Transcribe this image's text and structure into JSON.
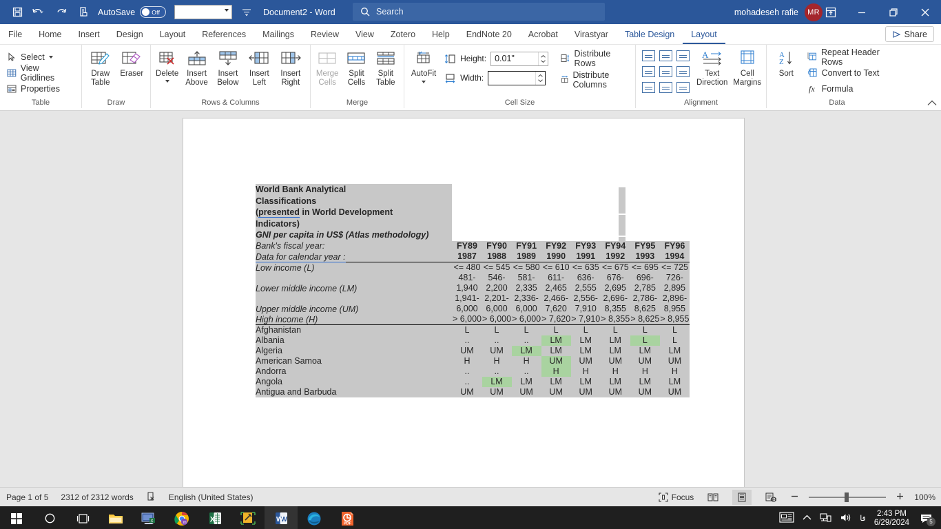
{
  "titlebar": {
    "autosave_label": "AutoSave",
    "autosave_state": "Off",
    "document_title": "Document2  -  Word",
    "search_placeholder": "Search",
    "account_name": "mohadeseh rafie",
    "account_initials": "MR",
    "icons": [
      "save-icon",
      "undo-icon",
      "redo-icon",
      "print-preview-icon",
      "customize-qat-icon",
      "ribbon-display-options-icon",
      "minimize-icon",
      "restore-icon",
      "close-icon"
    ]
  },
  "tabs": [
    {
      "label": "File",
      "state": "normal"
    },
    {
      "label": "Home",
      "state": "normal"
    },
    {
      "label": "Insert",
      "state": "normal"
    },
    {
      "label": "Design",
      "state": "normal"
    },
    {
      "label": "Layout",
      "state": "normal"
    },
    {
      "label": "References",
      "state": "normal"
    },
    {
      "label": "Mailings",
      "state": "normal"
    },
    {
      "label": "Review",
      "state": "normal"
    },
    {
      "label": "View",
      "state": "normal"
    },
    {
      "label": "Zotero",
      "state": "normal"
    },
    {
      "label": "Help",
      "state": "normal"
    },
    {
      "label": "EndNote 20",
      "state": "normal"
    },
    {
      "label": "Acrobat",
      "state": "normal"
    },
    {
      "label": "Virastyar",
      "state": "normal"
    },
    {
      "label": "Table Design",
      "state": "contextual"
    },
    {
      "label": "Layout",
      "state": "active"
    }
  ],
  "share_label": "Share",
  "ribbon": {
    "groups": [
      {
        "name": "Table",
        "small_items": [
          "Select",
          "View Gridlines",
          "Properties"
        ]
      },
      {
        "name": "Draw",
        "big_items": [
          {
            "line1": "Draw",
            "line2": "Table"
          },
          {
            "line1": "Eraser",
            "line2": ""
          }
        ]
      },
      {
        "name": "Rows & Columns",
        "big_items": [
          {
            "line1": "Delete",
            "line2": ""
          },
          {
            "line1": "Insert",
            "line2": "Above"
          },
          {
            "line1": "Insert",
            "line2": "Below"
          },
          {
            "line1": "Insert",
            "line2": "Left"
          },
          {
            "line1": "Insert",
            "line2": "Right"
          }
        ]
      },
      {
        "name": "Merge",
        "big_items": [
          {
            "line1": "Merge",
            "line2": "Cells",
            "disabled": true
          },
          {
            "line1": "Split",
            "line2": "Cells"
          },
          {
            "line1": "Split",
            "line2": "Table"
          }
        ]
      },
      {
        "name": "Cell Size",
        "autofit_label_1": "AutoFit",
        "height_label": "Height:",
        "height_value": "0.01\"",
        "width_label": "Width:",
        "width_value": "",
        "distribute_rows": "Distribute Rows",
        "distribute_columns": "Distribute Columns"
      },
      {
        "name": "Alignment",
        "text_direction_1": "Text",
        "text_direction_2": "Direction",
        "cell_margins_1": "Cell",
        "cell_margins_2": "Margins"
      },
      {
        "name": "Data",
        "sort_label": "Sort",
        "repeat_header_rows": "Repeat Header Rows",
        "convert_to_text": "Convert to Text",
        "formula": "Formula"
      }
    ]
  },
  "document": {
    "table_title_lines": [
      "World Bank Analytical",
      "Classifications",
      "(presented in World Development",
      "Indicators)"
    ],
    "title_misspelled_word": "presented",
    "table_subtitle": "GNI per capita in US$ (Atlas methodology)",
    "row_labels": {
      "fiscal_year": "Bank's fiscal year:",
      "calendar_year": "Data for calendar year :",
      "low": "Low income (L)",
      "lower_middle": "Lower middle income (LM)",
      "upper_middle": "Upper middle income (UM)",
      "high": "High income (H)"
    },
    "fiscal_years": [
      "FY89",
      "FY90",
      "FY91",
      "FY92",
      "FY93",
      "FY94",
      "FY95",
      "FY96"
    ],
    "calendar_years": [
      "1987",
      "1988",
      "1989",
      "1990",
      "1991",
      "1992",
      "1993",
      "1994"
    ],
    "low_income": [
      "<= 480",
      "<= 545",
      "<= 580",
      "<= 610",
      "<= 635",
      "<= 675",
      "<= 695",
      "<= 725"
    ],
    "lower_middle_income": [
      "481-1,940",
      "546-2,200",
      "581-2,335",
      "611-2,465",
      "636-2,555",
      "676-2,695",
      "696-2,785",
      "726-2,895"
    ],
    "upper_middle_income": [
      "1,941-6,000",
      "2,201-6,000",
      "2,336-6,000",
      "2,466-7,620",
      "2,556-7,910",
      "2,696-8,355",
      "2,786-8,625",
      "2,896-8,955"
    ],
    "high_income": [
      "> 6,000",
      "> 6,000",
      "> 6,000",
      "> 7,620",
      "> 7,910",
      "> 8,355",
      "> 8,625",
      "> 8,955"
    ],
    "countries": [
      {
        "name": "Afghanistan",
        "values": [
          "L",
          "L",
          "L",
          "L",
          "L",
          "L",
          "L",
          "L"
        ],
        "highlight": [
          false,
          false,
          false,
          false,
          false,
          false,
          false,
          false
        ]
      },
      {
        "name": "Albania",
        "values": [
          "..",
          "..",
          "..",
          "LM",
          "LM",
          "LM",
          "L",
          "L"
        ],
        "highlight": [
          false,
          false,
          false,
          true,
          false,
          false,
          true,
          false
        ]
      },
      {
        "name": "Algeria",
        "values": [
          "UM",
          "UM",
          "LM",
          "LM",
          "LM",
          "LM",
          "LM",
          "LM"
        ],
        "highlight": [
          false,
          false,
          true,
          false,
          false,
          false,
          false,
          false
        ]
      },
      {
        "name": "American Samoa",
        "values": [
          "H",
          "H",
          "H",
          "UM",
          "UM",
          "UM",
          "UM",
          "UM"
        ],
        "highlight": [
          false,
          false,
          false,
          true,
          false,
          false,
          false,
          false
        ]
      },
      {
        "name": "Andorra",
        "values": [
          "..",
          "..",
          "..",
          "H",
          "H",
          "H",
          "H",
          "H"
        ],
        "highlight": [
          false,
          false,
          false,
          true,
          false,
          false,
          false,
          false
        ]
      },
      {
        "name": "Angola",
        "values": [
          "..",
          "LM",
          "LM",
          "LM",
          "LM",
          "LM",
          "LM",
          "LM"
        ],
        "highlight": [
          false,
          true,
          false,
          false,
          false,
          false,
          false,
          false
        ]
      },
      {
        "name": "Antigua and Barbuda",
        "values": [
          "UM",
          "UM",
          "UM",
          "UM",
          "UM",
          "UM",
          "UM",
          "UM"
        ],
        "highlight": [
          false,
          false,
          false,
          false,
          false,
          false,
          false,
          false
        ]
      }
    ]
  },
  "statusbar": {
    "page": "Page 1 of 5",
    "words": "2312 of 2312 words",
    "language": "English (United States)",
    "focus_label": "Focus",
    "zoom_level": "100%",
    "proofing_icon": "proofing-errors-icon",
    "view_icons": [
      "read-mode-icon",
      "print-layout-icon",
      "web-layout-icon"
    ]
  },
  "taskbar": {
    "items": [
      "start-icon",
      "search-icon",
      "task-view-icon",
      "file-explorer-icon",
      "remote-desktop-icon",
      "chrome-icon",
      "excel-icon",
      "editor-icon",
      "word-icon",
      "edge-icon",
      "pdf-icon"
    ],
    "time": "2:43 PM",
    "date": "6/29/2024",
    "language_indicator": "فا",
    "notification_count": "5"
  },
  "colors": {
    "word_blue": "#2b579a",
    "accent_blue": "#2b6ad0",
    "table_shade": "#c8c8c8",
    "highlight_green": "#a9d3a0",
    "avatar_red": "#a4262c"
  }
}
